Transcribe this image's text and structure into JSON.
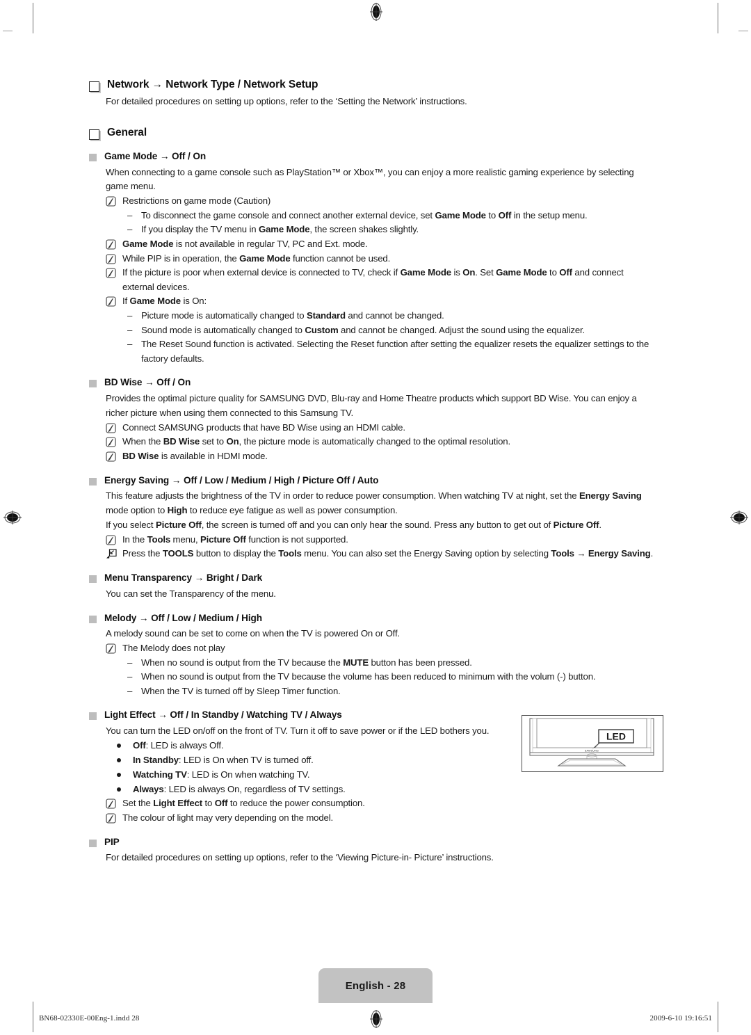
{
  "document": {
    "page_label": "English - 28",
    "footer_file": "BN68-02330E-00Eng-1.indd   28",
    "footer_timestamp": "2009-6-10   19:16:51"
  },
  "sections": {
    "network": {
      "heading": "Network → Network Type / Network Setup",
      "body": "For detailed procedures on setting up options, refer to the ‘Setting the Network’ instructions."
    },
    "general": {
      "heading": "General"
    },
    "game_mode": {
      "heading": "Game Mode → Off / On",
      "body": "When connecting to a game console such as PlayStation™ or Xbox™, you can enjoy a more realistic gaming experience by selecting game menu.",
      "note1": "Restrictions on game mode (Caution)",
      "dash1": "To disconnect the game console and connect another external device, set <b>Game Mode</b> to <b>Off</b> in the setup menu.",
      "dash2": "If you display the TV menu in <b>Game Mode</b>, the screen shakes slightly.",
      "note2": "<b>Game Mode</b> is not available in regular TV, PC and Ext. mode.",
      "note3": "While PIP is in operation, the <b>Game Mode</b> function cannot be used.",
      "note4": "If the picture is poor when external device is connected to TV, check if <b>Game Mode</b> is <b>On</b>. Set <b>Game Mode</b> to <b>Off</b> and connect external devices.",
      "note5": "If <b>Game Mode</b> is On:",
      "dash3": "Picture mode is automatically changed to <b>Standard</b> and cannot be changed.",
      "dash4": "Sound mode is automatically changed to <b>Custom</b> and cannot be changed. Adjust the sound using the equalizer.",
      "dash5": "The Reset Sound function is activated. Selecting the Reset function after setting the equalizer resets the equalizer settings to the factory defaults."
    },
    "bd_wise": {
      "heading": "BD Wise → Off / On",
      "body": "Provides the optimal picture quality for SAMSUNG DVD, Blu-ray and Home Theatre products which support BD Wise. You can enjoy a richer picture when using them connected to this Samsung TV.",
      "note1": "Connect SAMSUNG products that have BD Wise using an HDMI cable.",
      "note2": "When the <b>BD Wise</b> set to <b>On</b>, the picture mode is automatically changed to the optimal resolution.",
      "note3": "<b>BD Wise</b> is available in HDMI mode."
    },
    "energy_saving": {
      "heading": "Energy Saving → Off / Low / Medium / High / Picture Off / Auto",
      "body1": "This feature adjusts the brightness of the TV in order to reduce power consumption. When watching TV at night, set the <b>Energy Saving</b> mode option to <b>High</b> to reduce eye fatigue as well as power consumption.",
      "body2": "If you select <b>Picture Off</b>, the screen is turned off and you can only hear the sound. Press any button to get out of <b>Picture Off</b>.",
      "note1": "In the <b>Tools</b> menu, <b>Picture Off</b> function is not supported.",
      "tools_note": "Press the <b>TOOLS</b> button to display the <b>Tools</b> menu. You can also set the Energy Saving option by selecting <b>Tools → Energy Saving</b>."
    },
    "menu_transparency": {
      "heading": "Menu Transparency → Bright / Dark",
      "body": "You can set the Transparency of the menu."
    },
    "melody": {
      "heading": "Melody → Off / Low / Medium / High",
      "body": "A melody sound can be set to come on when the TV is powered On or Off.",
      "note1": "The Melody does not play",
      "dash1": "When no sound is output from the TV because the <b>MUTE</b> button has been pressed.",
      "dash2": "When no sound is output from the TV because the volume has been reduced to minimum with the volum (-) button.",
      "dash3": "When the TV is turned off by Sleep Timer function."
    },
    "light_effect": {
      "heading": "Light Effect → Off / In Standby / Watching TV / Always",
      "body": "You can turn the LED on/off on the front of TV. Turn it off to save power or if the LED bothers you.",
      "bullet1": "<b>Off</b>: LED is always Off.",
      "bullet2": "<b>In Standby</b>: LED is On when TV is turned off.",
      "bullet3": "<b>Watching TV</b>: LED is On when watching TV.",
      "bullet4": "<b>Always</b>: LED is always On, regardless of TV settings.",
      "note1": "Set the <b>Light Effect</b> to <b>Off</b> to reduce the power consumption.",
      "note2": "The colour of light may very depending on the model."
    },
    "pip": {
      "heading": "PIP",
      "body": "For detailed procedures on setting up options, refer to the ‘Viewing Picture-in- Picture’ instructions."
    }
  },
  "figure": {
    "callout_label": "LED",
    "brand_label": "SAMSUNG"
  }
}
